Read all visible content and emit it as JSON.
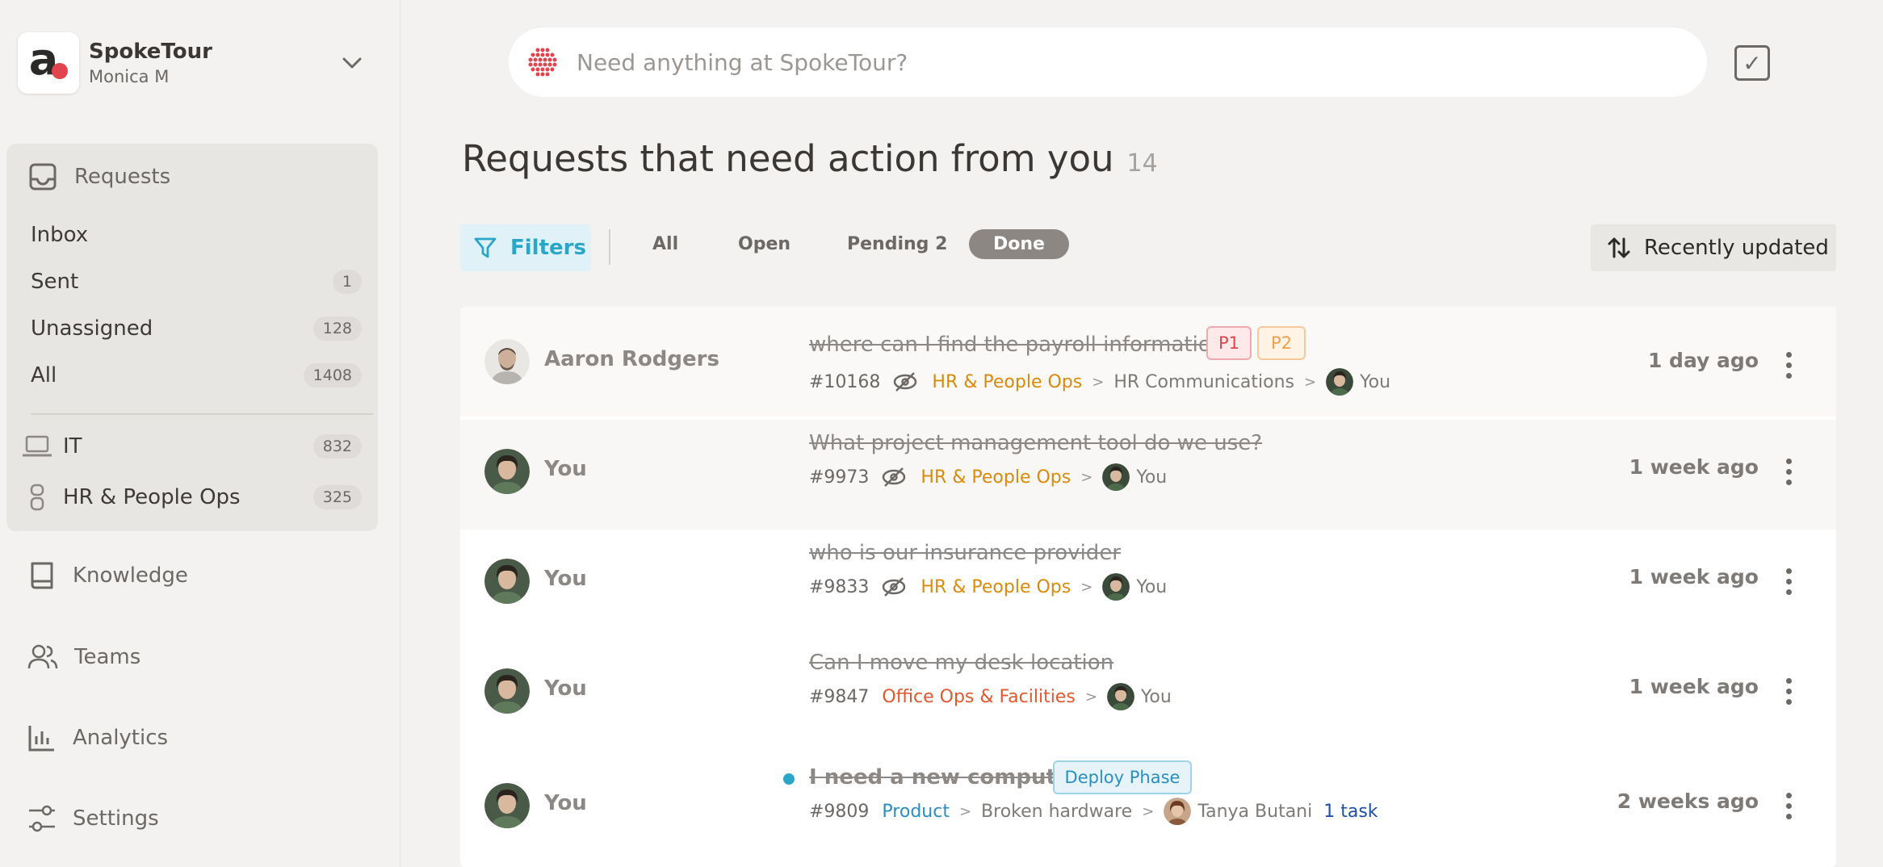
{
  "brand": {
    "name": "SpokeTour",
    "user": "Monica M",
    "logo_letter": "a"
  },
  "sidebar": {
    "requests_label": "Requests",
    "items": [
      {
        "label": "Inbox",
        "count": ""
      },
      {
        "label": "Sent",
        "count": "1"
      },
      {
        "label": "Unassigned",
        "count": "128"
      },
      {
        "label": "All",
        "count": "1408"
      }
    ],
    "teams": [
      {
        "label": "IT",
        "count": "832",
        "icon": "laptop-icon"
      },
      {
        "label": "HR & People Ops",
        "count": "325",
        "icon": "people-ops-icon"
      }
    ],
    "nav": [
      {
        "label": "Knowledge",
        "icon": "book-icon"
      },
      {
        "label": "Teams",
        "icon": "users-icon"
      },
      {
        "label": "Analytics",
        "icon": "chart-icon"
      },
      {
        "label": "Settings",
        "icon": "sliders-icon"
      }
    ]
  },
  "search": {
    "placeholder": "Need anything at SpokeTour?"
  },
  "header": {
    "title": "Requests that need action from you",
    "count": "14"
  },
  "toolbar": {
    "filters": "Filters",
    "tabs": [
      "All",
      "Open",
      "Pending 2",
      "Done"
    ],
    "active_tab": "Done",
    "sort": "Recently updated"
  },
  "requests": [
    {
      "requester": "Aaron Rodgers",
      "subject": "where can I find the payroll information",
      "tags": [
        "P1",
        "P2"
      ],
      "id": "#10168",
      "team": "HR & People Ops",
      "category": "HR Communications",
      "assignee": "You",
      "time": "1 day ago"
    },
    {
      "requester": "You",
      "subject": "What project management tool do we use?",
      "id": "#9973",
      "team": "HR & People Ops",
      "assignee": "You",
      "time": "1 week ago"
    },
    {
      "requester": "You",
      "subject": "who is our insurance provider",
      "id": "#9833",
      "team": "HR & People Ops",
      "assignee": "You",
      "time": "1 week ago"
    },
    {
      "requester": "You",
      "subject": "Can I move my desk location",
      "id": "#9847",
      "team": "Office Ops & Facilities",
      "assignee": "You",
      "time": "1 week ago"
    },
    {
      "requester": "You",
      "subject": "I need a new computer",
      "tags": [
        "Deploy Phase"
      ],
      "id": "#9809",
      "team": "Product",
      "category": "Broken hardware",
      "assignee": "Tanya Butani",
      "tasks": "1 task",
      "time": "2 weeks ago"
    }
  ],
  "colors": {
    "accent": "#2aa7c8",
    "hr_team": "#d98a0a",
    "office_team": "#e0582e",
    "brand_dot": "#e0444e",
    "p1": "#e0444e",
    "p2": "#f0a048"
  }
}
